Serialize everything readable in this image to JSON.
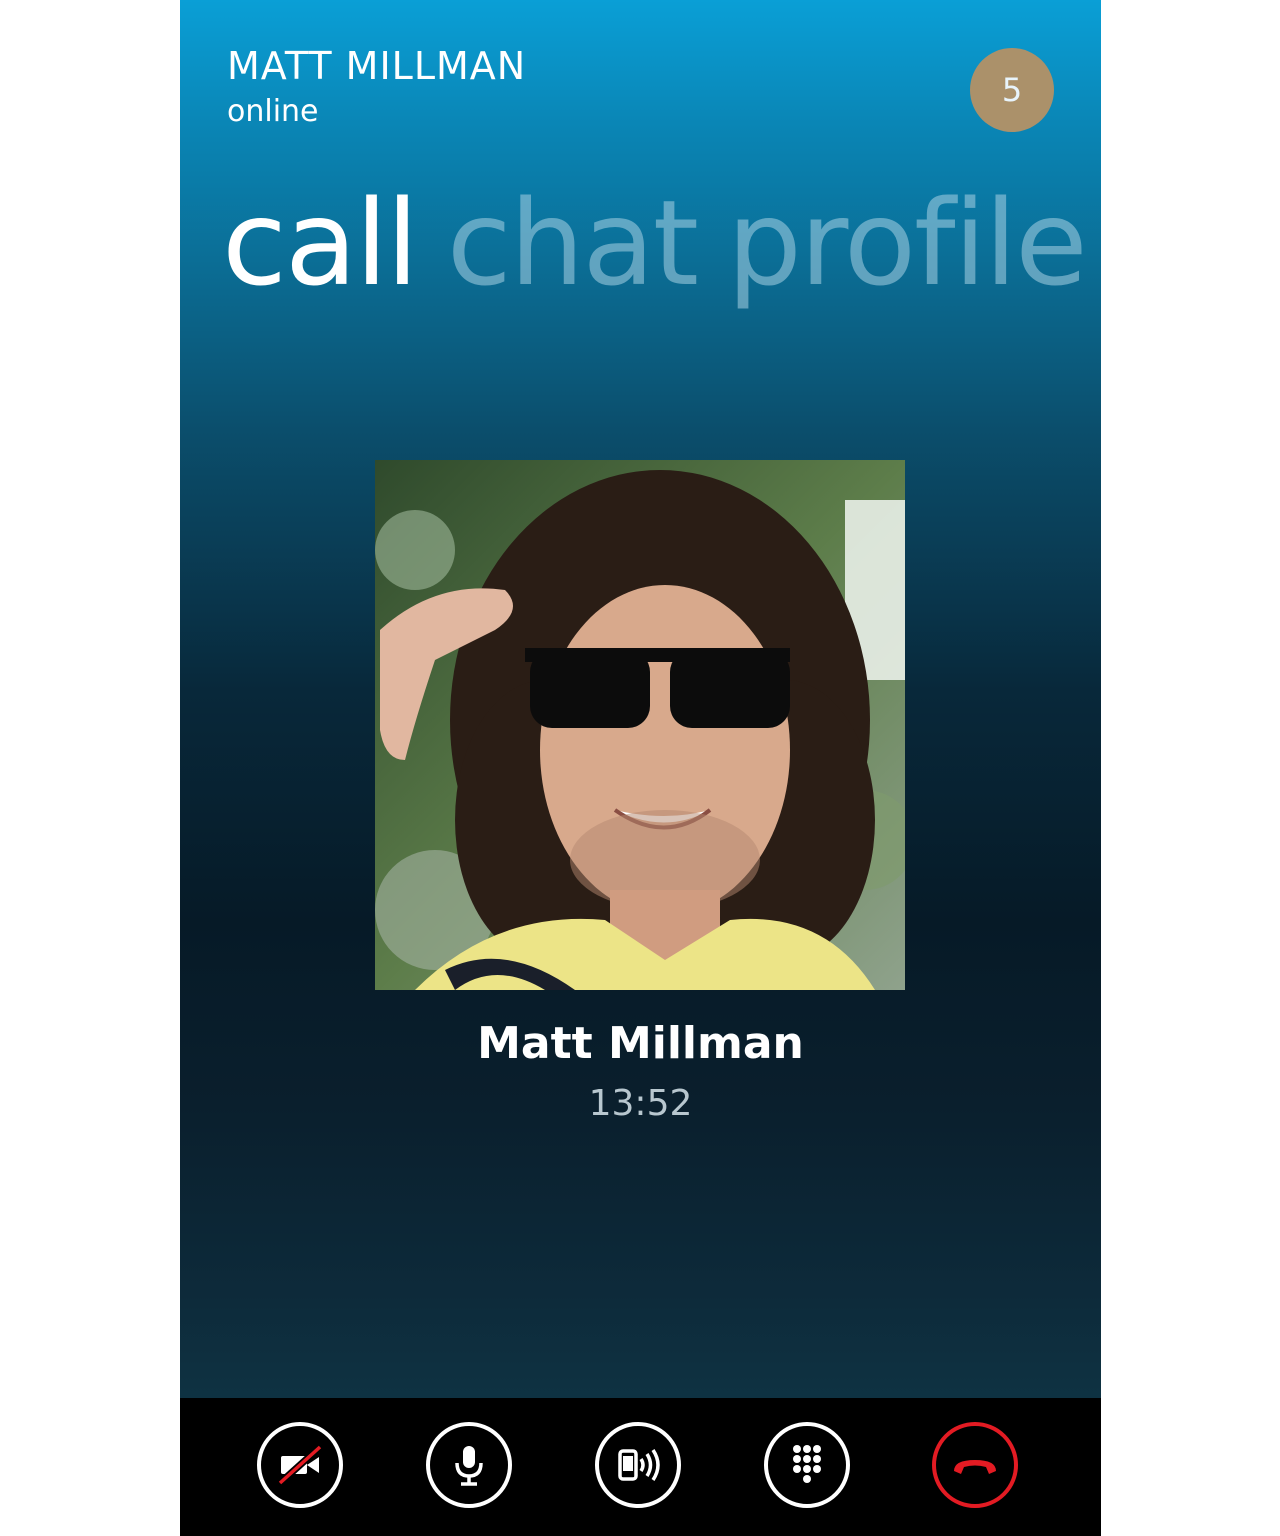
{
  "header": {
    "contact_name": "MATT MILLMAN",
    "status": "online",
    "notification_count": "5"
  },
  "pivot": {
    "tabs": [
      {
        "label": "call",
        "active": true
      },
      {
        "label": "chat",
        "active": false
      },
      {
        "label": "profile",
        "active": false
      }
    ]
  },
  "call": {
    "caller_name": "Matt Millman",
    "duration": "13:52"
  },
  "appbar": {
    "buttons": [
      {
        "name": "video-off",
        "icon": "video-off-icon"
      },
      {
        "name": "mute",
        "icon": "microphone-icon"
      },
      {
        "name": "speaker",
        "icon": "speakerphone-icon"
      },
      {
        "name": "keypad",
        "icon": "keypad-icon"
      },
      {
        "name": "end-call",
        "icon": "hang-up-icon"
      }
    ]
  },
  "colors": {
    "accent_top": "#0a9fd6",
    "badge": "#ab916a",
    "end_call": "#e31b23"
  }
}
